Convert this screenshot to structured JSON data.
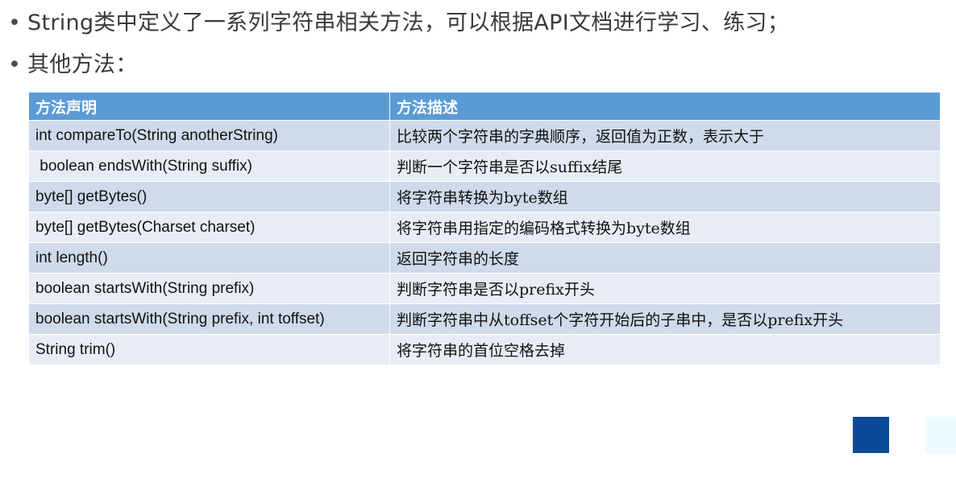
{
  "bullets": [
    "String类中定义了一系列字符串相关方法，可以根据API文档进行学习、练习；",
    "其他方法："
  ],
  "bullet_symbol": "•",
  "table": {
    "headers": [
      "方法声明",
      "方法描述"
    ],
    "rows": [
      [
        "int compareTo(String anotherString)",
        "比较两个字符串的字典顺序，返回值为正数，表示大于"
      ],
      [
        " boolean endsWith(String suffix)",
        "判断一个字符串是否以suffix结尾"
      ],
      [
        "byte[] getBytes()",
        "将字符串转换为byte数组"
      ],
      [
        "byte[] getBytes(Charset charset)",
        "将字符串用指定的编码格式转换为byte数组"
      ],
      [
        "int length()",
        "返回字符串的长度"
      ],
      [
        "boolean startsWith(String prefix)",
        "判断字符串是否以prefix开头"
      ],
      [
        "boolean startsWith(String prefix, int toffset)",
        "判断字符串中从toffset个字符开始后的子串中，是否以prefix开头"
      ],
      [
        "String trim()",
        "将字符串的首位空格去掉"
      ]
    ]
  },
  "colors": {
    "header_bg": "#5b9bd5",
    "row_odd": "#cfdaea",
    "row_even": "#e8edf5",
    "square_dark": "#0b4a97",
    "square_light": "#eefcff"
  }
}
